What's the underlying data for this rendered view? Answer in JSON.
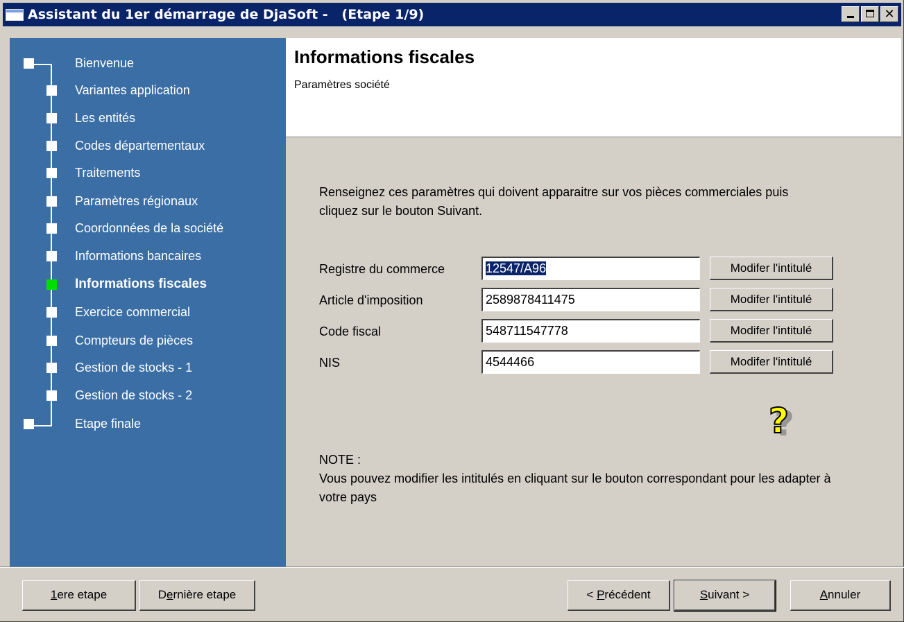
{
  "window": {
    "title": "Assistant du 1er démarrage de DjaSoft -   (Etape 1/9)",
    "minimize": "minimize",
    "maximize": "maximize",
    "close_glyph": "✕"
  },
  "sidebar": {
    "steps": [
      {
        "label": "Bienvenue"
      },
      {
        "label": "Variantes application"
      },
      {
        "label": "Les entités"
      },
      {
        "label": "Codes départementaux"
      },
      {
        "label": "Traitements"
      },
      {
        "label": "Paramètres régionaux"
      },
      {
        "label": "Coordonnées de la société"
      },
      {
        "label": "Informations bancaires"
      },
      {
        "label": "Informations fiscales"
      },
      {
        "label": "Exercice commercial"
      },
      {
        "label": "Compteurs de pièces"
      },
      {
        "label": "Gestion de stocks - 1"
      },
      {
        "label": "Gestion de stocks - 2"
      },
      {
        "label": "Etape finale"
      }
    ],
    "current_index": 8
  },
  "header": {
    "title": "Informations fiscales",
    "subtitle": "Paramètres société"
  },
  "content": {
    "intro": "Renseignez ces paramètres qui doivent apparaitre sur vos pièces commerciales puis cliquez sur le bouton Suivant.",
    "fields": [
      {
        "label": "Registre du commerce",
        "value": "12547/A96",
        "button": "Modifer l'intitulé"
      },
      {
        "label": "Article d'imposition",
        "value": "2589878411475",
        "button": "Modifer l'intitulé"
      },
      {
        "label": "Code fiscal",
        "value": "548711547778",
        "button": "Modifer l'intitulé"
      },
      {
        "label": "NIS",
        "value": "4544466",
        "button": "Modifer l'intitulé"
      }
    ],
    "note_title": "NOTE :",
    "note_text": "Vous pouvez modifier les intitulés en cliquant sur le bouton correspondant pour les adapter à votre pays"
  },
  "footer": {
    "first_step": {
      "u": "1",
      "rest": "ere etape"
    },
    "last_step": {
      "pre": "D",
      "u": "e",
      "rest": "rnière etape"
    },
    "previous": {
      "pre": "< ",
      "u": "P",
      "rest": "récédent"
    },
    "next": {
      "u": "S",
      "rest": "uivant >"
    },
    "cancel": {
      "u": "A",
      "rest": "nnuler"
    }
  },
  "colors": {
    "titlebar": "#0a246a",
    "sidebar": "#3a6ea5",
    "current_step": "#00e000",
    "face": "#d4d0c8"
  }
}
